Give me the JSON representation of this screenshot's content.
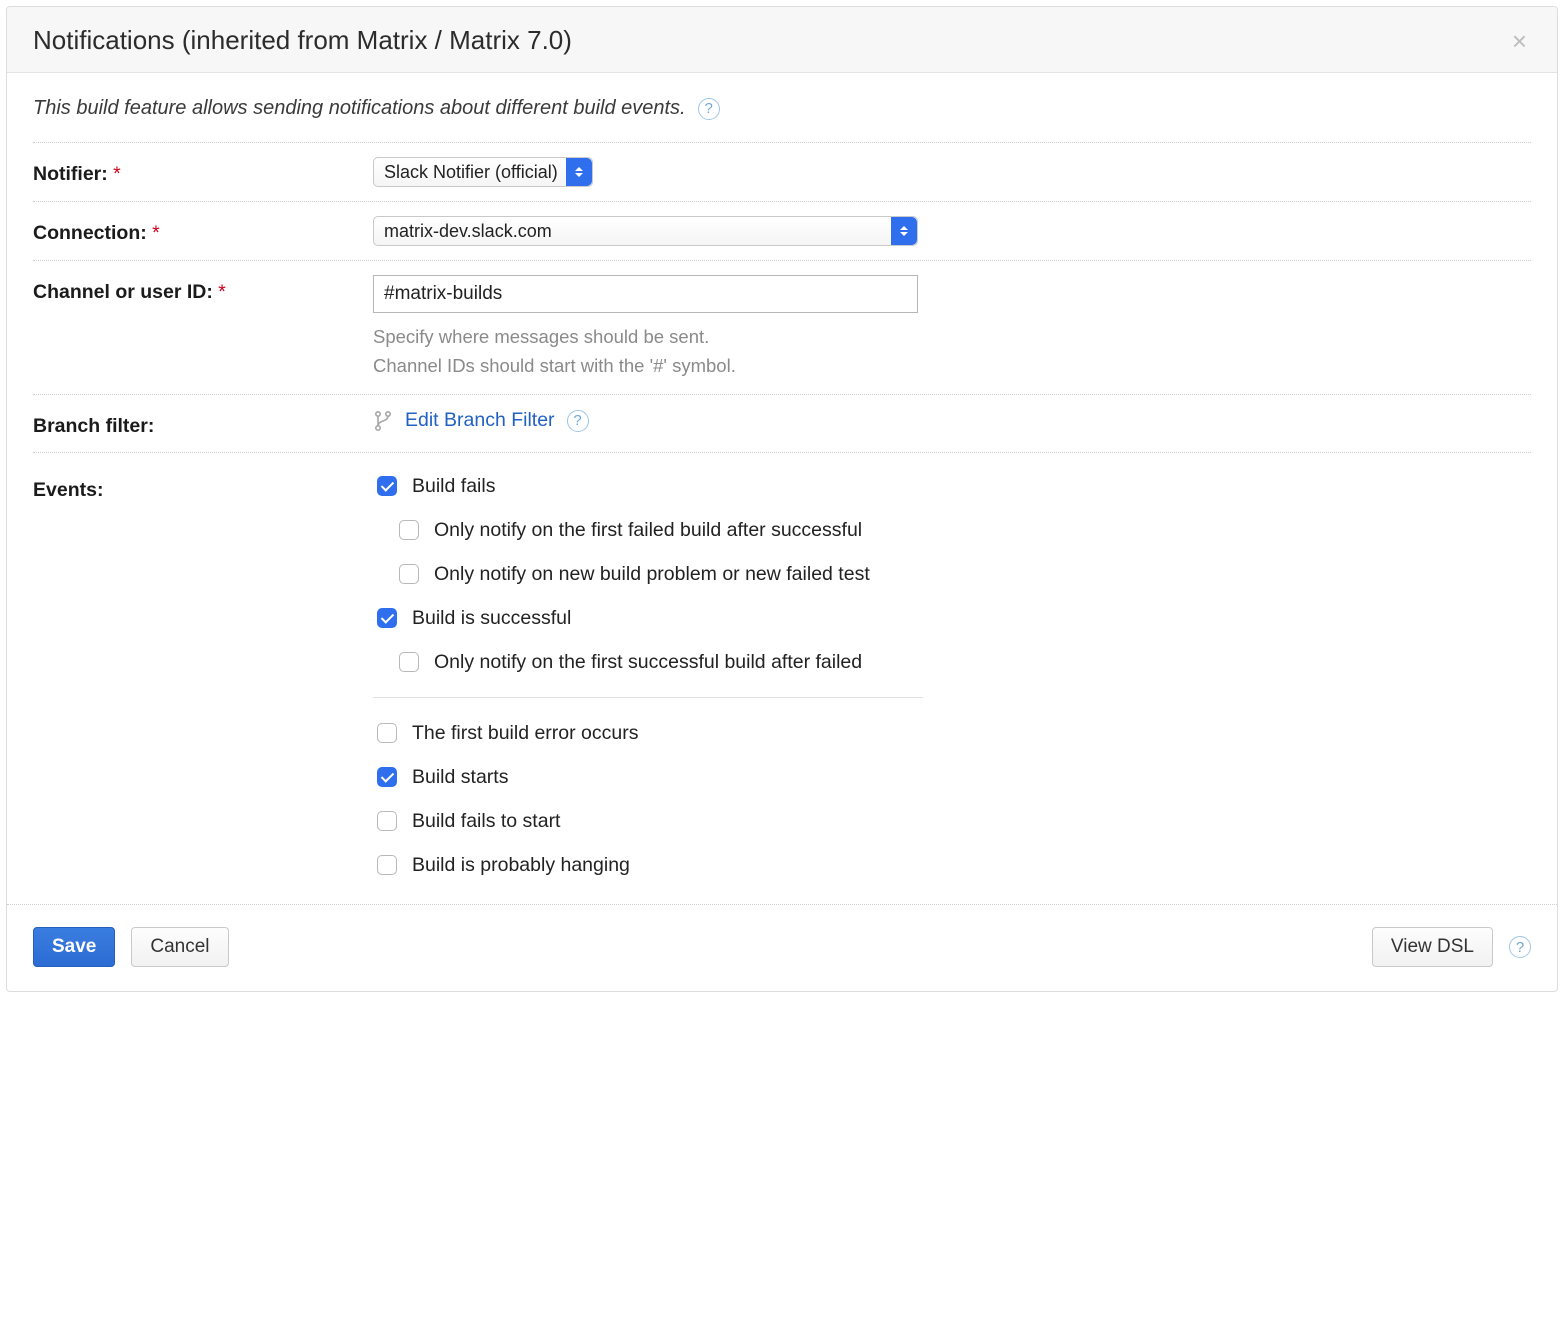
{
  "dialog": {
    "title": "Notifications (inherited from Matrix / Matrix 7.0)"
  },
  "intro": "This build feature allows sending notifications about different build events.",
  "labels": {
    "notifier": "Notifier:",
    "connection": "Connection:",
    "channel": "Channel or user ID:",
    "branch_filter": "Branch filter:",
    "events": "Events:"
  },
  "fields": {
    "notifier_value": "Slack Notifier (official)",
    "connection_value": "matrix-dev.slack.com",
    "channel_value": "#matrix-builds",
    "channel_hint_1": "Specify where messages should be sent.",
    "channel_hint_2": "Channel IDs should start with the '#' symbol.",
    "branch_filter_link": "Edit Branch Filter"
  },
  "events": [
    {
      "label": "Build fails",
      "checked": true,
      "sub": false
    },
    {
      "label": "Only notify on the first failed build after successful",
      "checked": false,
      "sub": true
    },
    {
      "label": "Only notify on new build problem or new failed test",
      "checked": false,
      "sub": true
    },
    {
      "label": "Build is successful",
      "checked": true,
      "sub": false
    },
    {
      "label": "Only notify on the first successful build after failed",
      "checked": false,
      "sub": true
    },
    {
      "divider": true
    },
    {
      "label": "The first build error occurs",
      "checked": false,
      "sub": false
    },
    {
      "label": "Build starts",
      "checked": true,
      "sub": false
    },
    {
      "label": "Build fails to start",
      "checked": false,
      "sub": false
    },
    {
      "label": "Build is probably hanging",
      "checked": false,
      "sub": false
    }
  ],
  "buttons": {
    "save": "Save",
    "cancel": "Cancel",
    "view_dsl": "View DSL"
  }
}
